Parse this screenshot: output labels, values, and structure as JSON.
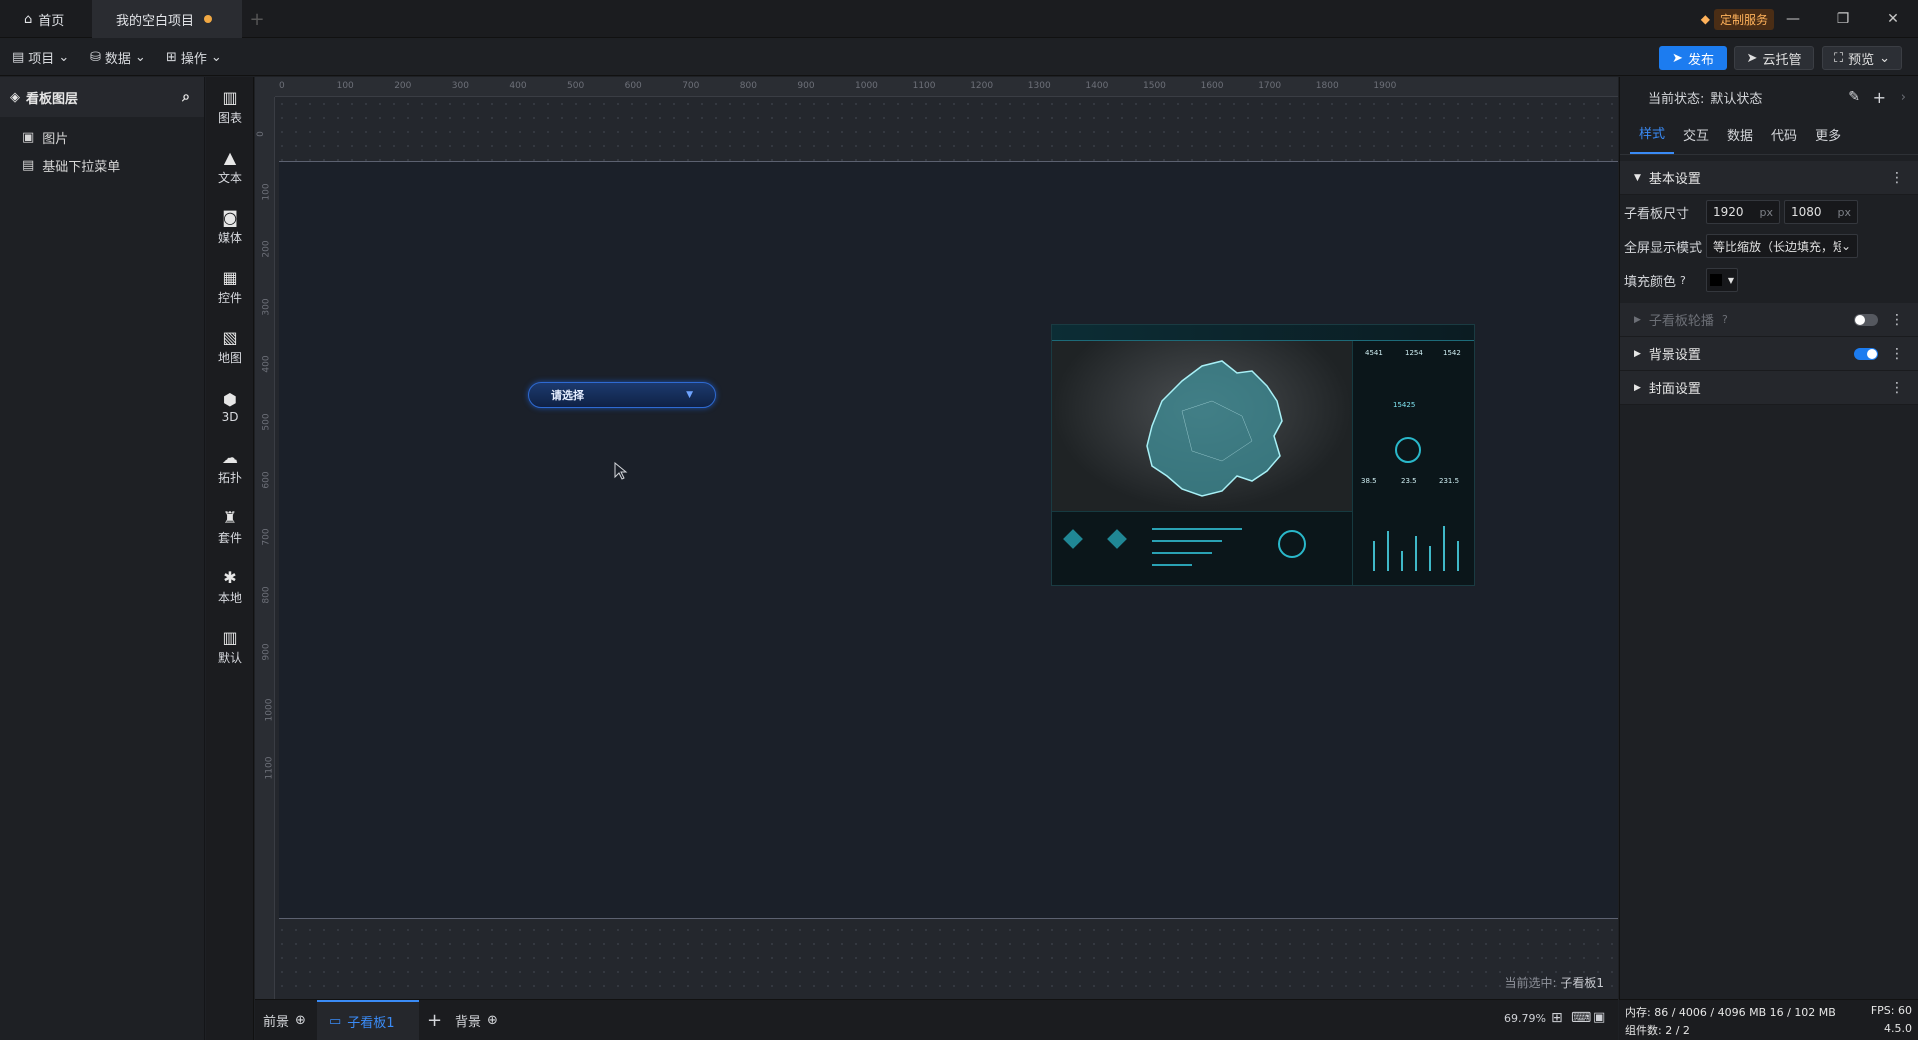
{
  "titlebar": {
    "home_tab": "首页",
    "project_tab": "我的空白项目",
    "custom_service": "定制服务"
  },
  "menubar": {
    "project": "项目",
    "data": "数据",
    "ops": "操作",
    "publish": "发布",
    "cloud": "云托管",
    "preview": "预览"
  },
  "layers": {
    "title": "看板图层",
    "items": [
      "图片",
      "基础下拉菜单"
    ]
  },
  "components": [
    "图表",
    "文本",
    "媒体",
    "控件",
    "地图",
    "3D",
    "拓扑",
    "套件",
    "本地",
    "默认"
  ],
  "ruler": {
    "h": [
      "0",
      "100",
      "200",
      "300",
      "400",
      "500",
      "600",
      "700",
      "800",
      "900",
      "1000",
      "1100",
      "1200",
      "1300",
      "1400",
      "1500",
      "1600",
      "1700",
      "1800",
      "1900"
    ],
    "v": [
      "0",
      "100",
      "200",
      "300",
      "400",
      "500",
      "600",
      "700",
      "800",
      "900",
      "1000",
      "1100"
    ]
  },
  "canvas": {
    "dropdown_text": "请选择",
    "dropdown_arrow": "▼",
    "selected_label": "当前选中:",
    "selected_value": "子看板1"
  },
  "dashboard_image": {
    "kpis": [
      "4541",
      "1254",
      "1542"
    ],
    "big_number": "15425",
    "stats": [
      "38.5",
      "23.5",
      "231.5"
    ]
  },
  "board_tabs": {
    "foreground": "前景",
    "sub_board": "子看板1",
    "add": "+",
    "background": "背景",
    "zoom": "69.79%"
  },
  "props": {
    "state_label": "当前状态:",
    "state_value": "默认状态",
    "tabs": [
      "样式",
      "交互",
      "数据",
      "代码",
      "更多"
    ],
    "basic_section": "基本设置",
    "size_label": "子看板尺寸",
    "width": "1920",
    "height": "1080",
    "unit": "px",
    "fullscreen_label": "全屏显示模式",
    "fullscreen_value": "等比缩放（长边填充，短...",
    "fill_label": "填充颜色",
    "carousel_section": "子看板轮播",
    "bg_section": "背景设置",
    "cover_section": "封面设置"
  },
  "status": {
    "memory": "内存: 86 / 4006 / 4096 MB 16 / 102 MB",
    "fps": "FPS: 60",
    "components": "组件数: 2 / 2",
    "version": "4.5.0"
  },
  "colors": {
    "accent": "#3a8bf6",
    "publish": "#1c7cf0",
    "modified_dot": "#f0a843"
  }
}
